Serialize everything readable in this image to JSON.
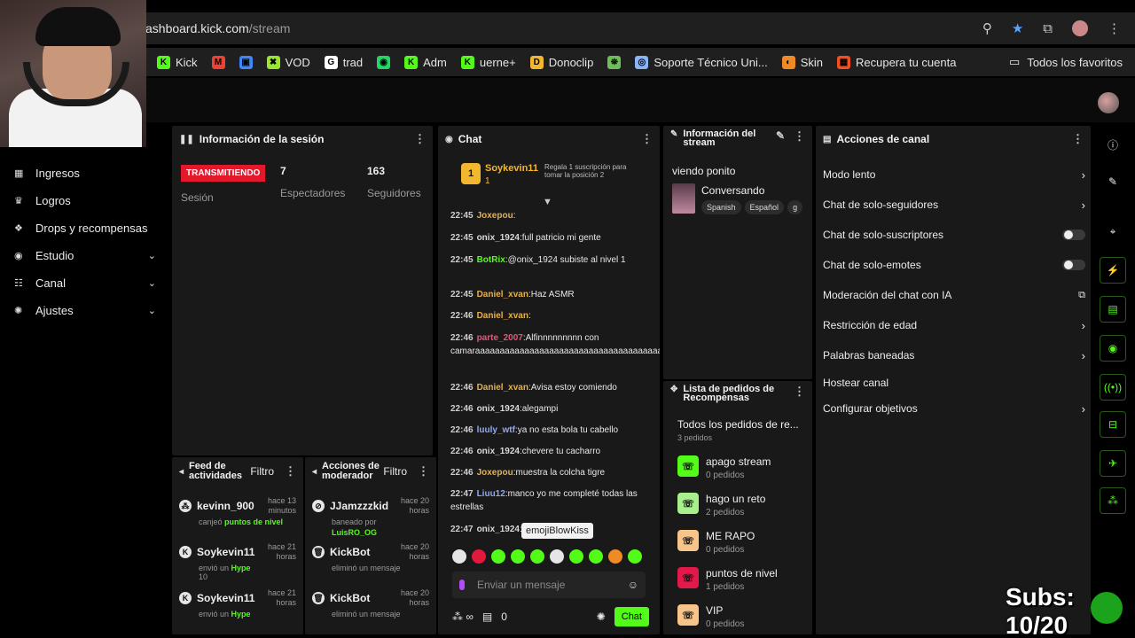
{
  "browser": {
    "url_host": "ashboard.kick.com",
    "url_path": "/stream",
    "bookmarks": [
      {
        "label": "Kick",
        "color": "#53fc18",
        "glyph": "K"
      },
      {
        "label": "",
        "color": "#ea4335",
        "glyph": "M"
      },
      {
        "label": "",
        "color": "#4285f4",
        "glyph": "▣"
      },
      {
        "label": "VOD",
        "color": "#9ae62e",
        "glyph": "✖"
      },
      {
        "label": "trad",
        "color": "#ffffff",
        "glyph": "G"
      },
      {
        "label": "",
        "color": "#25d366",
        "glyph": "◉"
      },
      {
        "label": "Adm",
        "color": "#53fc18",
        "glyph": "K"
      },
      {
        "label": "uerne+",
        "color": "#53fc18",
        "glyph": "K"
      },
      {
        "label": "Donoclip",
        "color": "#f2b72f",
        "glyph": "D"
      },
      {
        "label": "",
        "color": "#6cbf5a",
        "glyph": "⛯"
      },
      {
        "label": "Soporte Técnico Uni...",
        "color": "#8ab4f8",
        "glyph": "◎"
      },
      {
        "label": "Skin",
        "color": "#f08a24",
        "glyph": "◐"
      },
      {
        "label": "Recupera tu cuenta",
        "color": "#f25022",
        "glyph": "▦"
      }
    ],
    "all_favorites": "Todos los favoritos"
  },
  "nav": {
    "items": [
      {
        "label": "Ingresos",
        "icon": "revenue-icon",
        "glyph": "▦",
        "chevron": false
      },
      {
        "label": "Logros",
        "icon": "trophy-icon",
        "glyph": "♛",
        "chevron": false
      },
      {
        "label": "Drops y recompensas",
        "icon": "gift-icon",
        "glyph": "❖",
        "chevron": false
      },
      {
        "label": "Estudio",
        "icon": "studio-icon",
        "glyph": "◉",
        "chevron": true
      },
      {
        "label": "Canal",
        "icon": "channel-icon",
        "glyph": "☷",
        "chevron": true
      },
      {
        "label": "Ajustes",
        "icon": "settings-icon",
        "glyph": "✺",
        "chevron": true
      }
    ]
  },
  "session": {
    "title": "Información de la sesión",
    "badge": "TRANSMITIENDO",
    "session_label": "Sesión",
    "viewers": "7",
    "viewers_label": "Espectadores",
    "followers": "163",
    "followers_label": "Seguidores"
  },
  "chat": {
    "title": "Chat",
    "pinned_user": "Soykevin11",
    "pinned_sub": "1",
    "pinned_gift": "Regala 1 suscripción para tomar la posición 2",
    "messages": [
      {
        "time": "22:45",
        "user": "Joxepou",
        "color": "#e8b04a",
        "text": ""
      },
      {
        "time": "22:45",
        "user": "onix_1924",
        "color": "#d9d9d9",
        "text": "full patricio mi gente"
      },
      {
        "time": "22:45",
        "user": "BotRix",
        "color": "#53fc18",
        "text": "@onix_1924 subiste al nivel 1"
      },
      {
        "time": "22:45",
        "user": "Daniel_xvan",
        "color": "#e8b04a",
        "text": "Haz ASMR"
      },
      {
        "time": "22:46",
        "user": "Daniel_xvan",
        "color": "#e8b04a",
        "text": ""
      },
      {
        "time": "22:46",
        "user": "parte_2007",
        "color": "#e05a7a",
        "text": "Alfinnnnnnnnn con camaraaaaaaaaaaaaaaaaaaaaaaaaaaaaaaaaaaaaaaaaaaaaaaaaaaaaaaaaaaaaaa"
      },
      {
        "time": "22:46",
        "user": "Daniel_xvan",
        "color": "#e8b04a",
        "text": "Avisa estoy comiendo"
      },
      {
        "time": "22:46",
        "user": "onix_1924",
        "color": "#d9d9d9",
        "text": "alegampi"
      },
      {
        "time": "22:46",
        "user": "luuly_wtf",
        "color": "#8fa8ff",
        "text": "ya no esta bola tu cabello"
      },
      {
        "time": "22:46",
        "user": "onix_1924",
        "color": "#d9d9d9",
        "text": "chevere tu cacharro"
      },
      {
        "time": "22:46",
        "user": "Joxepou",
        "color": "#e8b04a",
        "text": "muestra la colcha tigre"
      },
      {
        "time": "22:47",
        "user": "Liuu12",
        "color": "#8fa8ff",
        "text": "manco yo me completé todas las estrellas"
      },
      {
        "time": "22:47",
        "user": "onix_1924",
        "color": "#d9d9d9",
        "text": ""
      }
    ],
    "tooltip": "emojiBlowKiss",
    "input_placeholder": "Enviar un mensaje",
    "footer_count": "0",
    "send_label": "Chat"
  },
  "stream_info": {
    "title": "Información del stream",
    "stream_title": "viendo ponito",
    "category": "Conversando",
    "tags": [
      "Spanish",
      "Español",
      "g"
    ]
  },
  "rewards": {
    "title": "Lista de pedidos de Recompensas",
    "all_title": "Todos los pedidos de re...",
    "all_count": "3 pedidos",
    "items": [
      {
        "name": "apago stream",
        "count": "0 pedidos",
        "color": "#53fc18"
      },
      {
        "name": "hago un reto",
        "count": "2 pedidos",
        "color": "#a8f08c"
      },
      {
        "name": "ME RAPO",
        "count": "0 pedidos",
        "color": "#f7c48a"
      },
      {
        "name": "puntos de nivel",
        "count": "1 pedidos",
        "color": "#e3194b"
      },
      {
        "name": "VIP",
        "count": "0 pedidos",
        "color": "#f7c48a"
      }
    ]
  },
  "actions": {
    "title": "Acciones de canal",
    "items": [
      {
        "label": "Modo lento",
        "kind": "chevron"
      },
      {
        "label": "Chat de solo-seguidores",
        "kind": "chevron"
      },
      {
        "label": "Chat de solo-suscriptores",
        "kind": "toggle"
      },
      {
        "label": "Chat de solo-emotes",
        "kind": "toggle"
      },
      {
        "label": "Moderación del chat con IA",
        "kind": "external"
      },
      {
        "label": "Restricción de edad",
        "kind": "chevron"
      },
      {
        "label": "Palabras baneadas",
        "kind": "chevron"
      },
      {
        "label": "Hostear canal",
        "kind": "none"
      },
      {
        "label": "Configurar objetivos",
        "kind": "chevron"
      }
    ]
  },
  "feed": {
    "title": "Feed de actividades",
    "filter": "Filtro",
    "items": [
      {
        "user": "kevinn_900",
        "ago": "hace 13 minutos",
        "pre": "canjeó ",
        "hl": "puntos de nivel",
        "post": ""
      },
      {
        "user": "Soykevin11",
        "ago": "hace 21 horas",
        "pre": "envió un ",
        "hl": "Hype",
        "post": "10"
      },
      {
        "user": "Soykevin11",
        "ago": "hace 21 horas",
        "pre": "envió un ",
        "hl": "Hype",
        "post": ""
      }
    ]
  },
  "mod": {
    "title": "Acciones de moderador",
    "filter": "Filtro",
    "items": [
      {
        "user": "JJamzzzkid",
        "ago": "hace 20 horas",
        "detail": "baneado por",
        "by": "LuisRO_OG"
      },
      {
        "user": "KickBot",
        "ago": "hace 20 horas",
        "detail": "eliminó un mensaje",
        "by": ""
      },
      {
        "user": "KickBot",
        "ago": "hace 20 horas",
        "detail": "eliminó un mensaje",
        "by": ""
      }
    ]
  },
  "overlay": {
    "subs": "Subs: 10/20"
  }
}
